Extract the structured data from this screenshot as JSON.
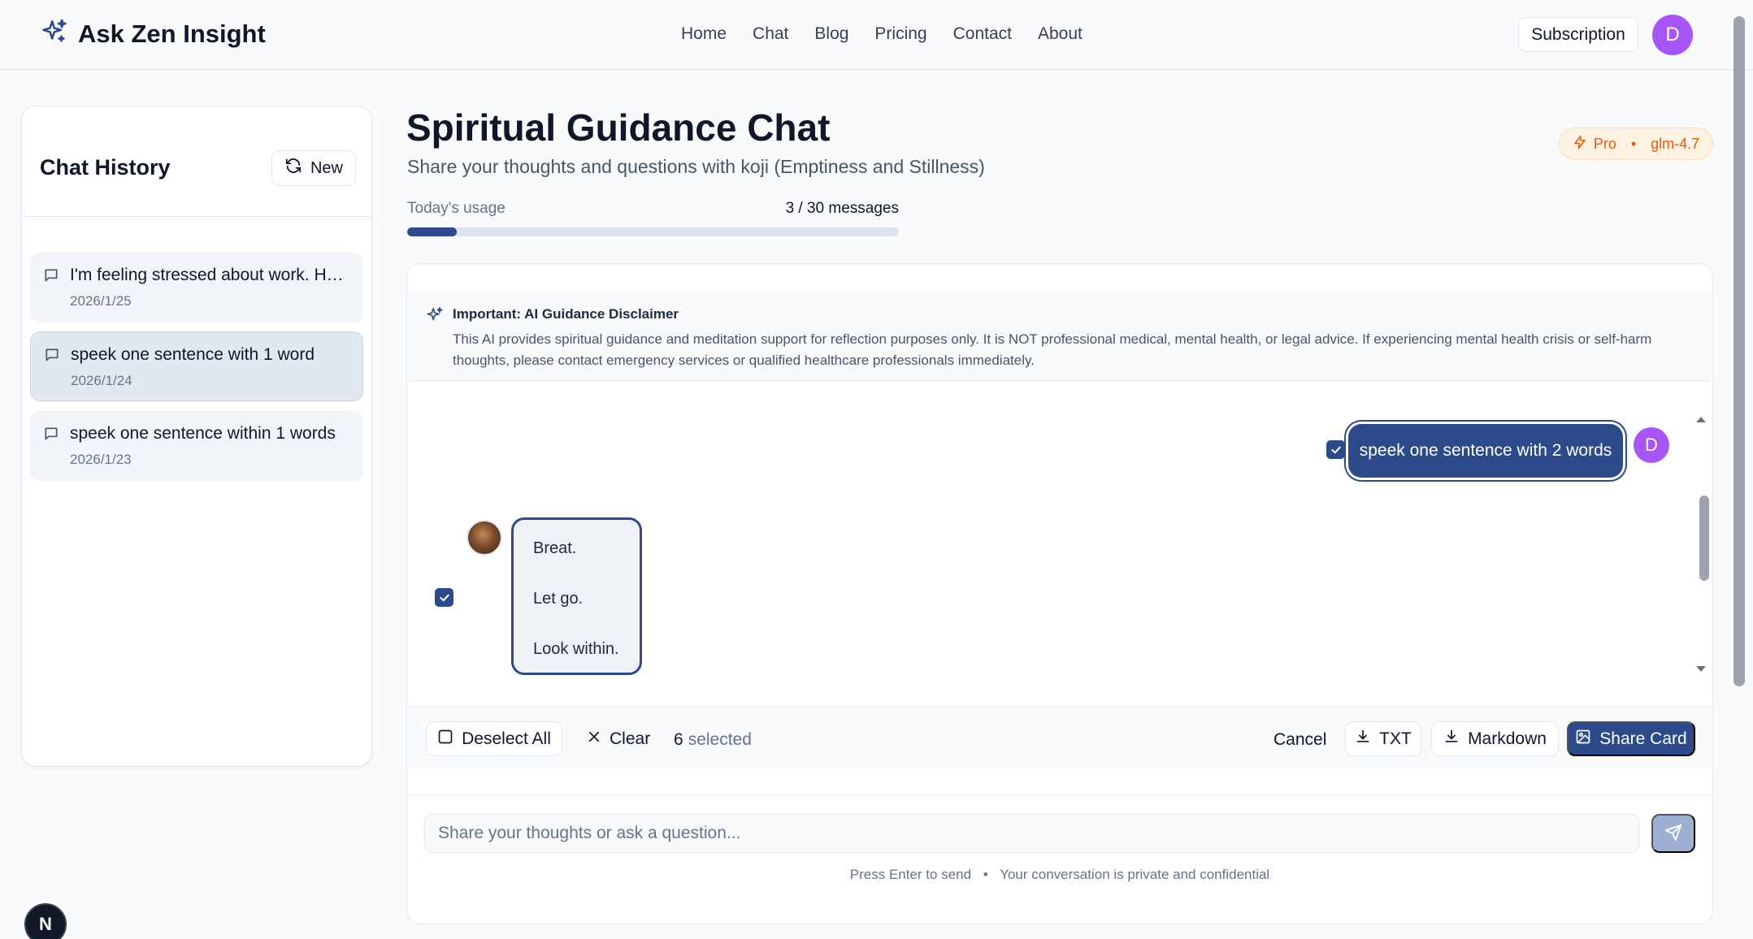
{
  "header": {
    "brand": "Ask Zen Insight",
    "nav": [
      "Home",
      "Chat",
      "Blog",
      "Pricing",
      "Contact",
      "About"
    ],
    "subscription_label": "Subscription",
    "avatar_initial": "D"
  },
  "sidebar": {
    "title": "Chat History",
    "new_label": "New",
    "items": [
      {
        "title": "I'm feeling stressed about work. How can I find inner peace?",
        "date": "2026/1/25",
        "active": false
      },
      {
        "title": "speek one sentence with 1 word",
        "date": "2026/1/24",
        "active": true
      },
      {
        "title": "speek one sentence within 1 words",
        "date": "2026/1/23",
        "active": false
      }
    ]
  },
  "main": {
    "title": "Spiritual Guidance Chat",
    "subtitle": "Share your thoughts and questions with koji (Emptiness and Stillness)",
    "badge": {
      "plan": "Pro",
      "separator": "•",
      "model": "glm-4.7"
    },
    "usage": {
      "label": "Today's usage",
      "count_text": "3 / 30 messages",
      "used": 3,
      "limit": 30
    }
  },
  "disclaimer": {
    "title": "Important: AI Guidance Disclaimer",
    "text": "This AI provides spiritual guidance and meditation support for reflection purposes only. It is NOT professional medical, mental health, or legal advice. If experiencing mental health crisis or self-harm thoughts, please contact emergency services or qualified healthcare professionals immediately."
  },
  "messages": {
    "user_text": "speek one sentence with 2 words",
    "user_initial": "D",
    "bot_lines": [
      "Breat.",
      "Let go.",
      "Look within."
    ]
  },
  "selection_bar": {
    "deselect_label": "Deselect All",
    "clear_label": "Clear",
    "selected_count": "6",
    "selected_suffix": "selected",
    "cancel_label": "Cancel",
    "txt_label": "TXT",
    "markdown_label": "Markdown",
    "share_label": "Share Card"
  },
  "composer": {
    "placeholder": "Share your thoughts or ask a question...",
    "hint_left": "Press Enter to send",
    "hint_sep": "•",
    "hint_right": "Your conversation is private and confidential"
  },
  "dev_badge": "N",
  "colors": {
    "primary": "#2d4a8a",
    "avatar": "#a855f7",
    "pro_badge": "#ea580c"
  }
}
